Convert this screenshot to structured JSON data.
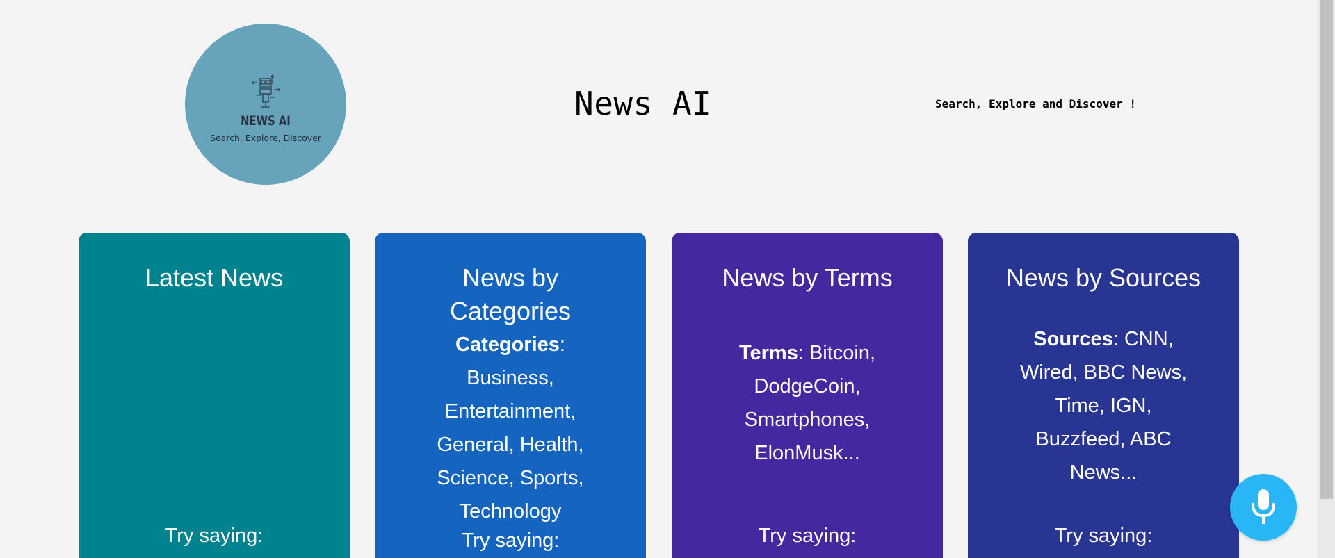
{
  "header": {
    "logo": {
      "name": "NEWS AI",
      "tagline": "Search, Explore, Discover",
      "color": "#67a3bb"
    },
    "title": "News AI",
    "tagline": "Search, Explore and Discover !"
  },
  "cards": [
    {
      "title": "Latest News",
      "try_label": "Try saying:",
      "color": "#00838f"
    },
    {
      "title": "News by Categories",
      "info_label": "Categories",
      "info_text": "Business, Entertainment, General, Health, Science, Sports, Technology",
      "try_label": "Try saying:",
      "color": "#1565c0"
    },
    {
      "title": "News by Terms",
      "info_label": "Terms",
      "info_text": "Bitcoin, DodgeCoin, Smartphones, ElonMusk...",
      "try_label": "Try saying:",
      "color": "#4527a0"
    },
    {
      "title": "News by Sources",
      "info_label": "Sources",
      "info_text": "CNN, Wired, BBC News, Time, IGN, Buzzfeed, ABC News...",
      "try_label": "Try saying:",
      "color": "#283593"
    }
  ],
  "voice_button": {
    "icon": "microphone-icon",
    "color": "#29b6f6"
  }
}
